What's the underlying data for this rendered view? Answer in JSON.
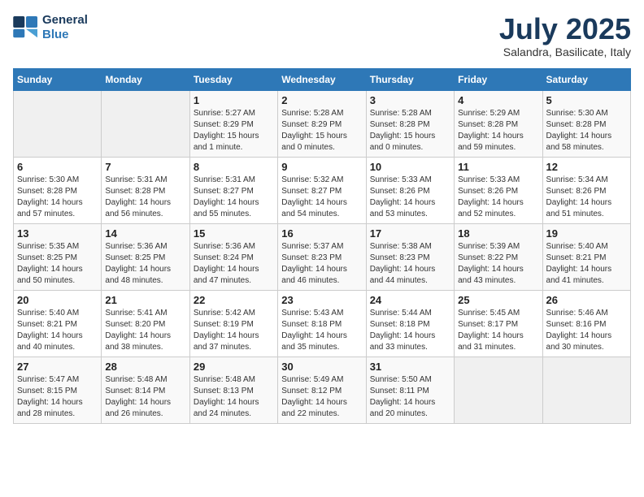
{
  "logo": {
    "line1": "General",
    "line2": "Blue"
  },
  "title": "July 2025",
  "subtitle": "Salandra, Basilicate, Italy",
  "headers": [
    "Sunday",
    "Monday",
    "Tuesday",
    "Wednesday",
    "Thursday",
    "Friday",
    "Saturday"
  ],
  "weeks": [
    [
      {
        "day": "",
        "sunrise": "",
        "sunset": "",
        "daylight": ""
      },
      {
        "day": "",
        "sunrise": "",
        "sunset": "",
        "daylight": ""
      },
      {
        "day": "1",
        "sunrise": "Sunrise: 5:27 AM",
        "sunset": "Sunset: 8:29 PM",
        "daylight": "Daylight: 15 hours and 1 minute."
      },
      {
        "day": "2",
        "sunrise": "Sunrise: 5:28 AM",
        "sunset": "Sunset: 8:29 PM",
        "daylight": "Daylight: 15 hours and 0 minutes."
      },
      {
        "day": "3",
        "sunrise": "Sunrise: 5:28 AM",
        "sunset": "Sunset: 8:28 PM",
        "daylight": "Daylight: 15 hours and 0 minutes."
      },
      {
        "day": "4",
        "sunrise": "Sunrise: 5:29 AM",
        "sunset": "Sunset: 8:28 PM",
        "daylight": "Daylight: 14 hours and 59 minutes."
      },
      {
        "day": "5",
        "sunrise": "Sunrise: 5:30 AM",
        "sunset": "Sunset: 8:28 PM",
        "daylight": "Daylight: 14 hours and 58 minutes."
      }
    ],
    [
      {
        "day": "6",
        "sunrise": "Sunrise: 5:30 AM",
        "sunset": "Sunset: 8:28 PM",
        "daylight": "Daylight: 14 hours and 57 minutes."
      },
      {
        "day": "7",
        "sunrise": "Sunrise: 5:31 AM",
        "sunset": "Sunset: 8:28 PM",
        "daylight": "Daylight: 14 hours and 56 minutes."
      },
      {
        "day": "8",
        "sunrise": "Sunrise: 5:31 AM",
        "sunset": "Sunset: 8:27 PM",
        "daylight": "Daylight: 14 hours and 55 minutes."
      },
      {
        "day": "9",
        "sunrise": "Sunrise: 5:32 AM",
        "sunset": "Sunset: 8:27 PM",
        "daylight": "Daylight: 14 hours and 54 minutes."
      },
      {
        "day": "10",
        "sunrise": "Sunrise: 5:33 AM",
        "sunset": "Sunset: 8:26 PM",
        "daylight": "Daylight: 14 hours and 53 minutes."
      },
      {
        "day": "11",
        "sunrise": "Sunrise: 5:33 AM",
        "sunset": "Sunset: 8:26 PM",
        "daylight": "Daylight: 14 hours and 52 minutes."
      },
      {
        "day": "12",
        "sunrise": "Sunrise: 5:34 AM",
        "sunset": "Sunset: 8:26 PM",
        "daylight": "Daylight: 14 hours and 51 minutes."
      }
    ],
    [
      {
        "day": "13",
        "sunrise": "Sunrise: 5:35 AM",
        "sunset": "Sunset: 8:25 PM",
        "daylight": "Daylight: 14 hours and 50 minutes."
      },
      {
        "day": "14",
        "sunrise": "Sunrise: 5:36 AM",
        "sunset": "Sunset: 8:25 PM",
        "daylight": "Daylight: 14 hours and 48 minutes."
      },
      {
        "day": "15",
        "sunrise": "Sunrise: 5:36 AM",
        "sunset": "Sunset: 8:24 PM",
        "daylight": "Daylight: 14 hours and 47 minutes."
      },
      {
        "day": "16",
        "sunrise": "Sunrise: 5:37 AM",
        "sunset": "Sunset: 8:23 PM",
        "daylight": "Daylight: 14 hours and 46 minutes."
      },
      {
        "day": "17",
        "sunrise": "Sunrise: 5:38 AM",
        "sunset": "Sunset: 8:23 PM",
        "daylight": "Daylight: 14 hours and 44 minutes."
      },
      {
        "day": "18",
        "sunrise": "Sunrise: 5:39 AM",
        "sunset": "Sunset: 8:22 PM",
        "daylight": "Daylight: 14 hours and 43 minutes."
      },
      {
        "day": "19",
        "sunrise": "Sunrise: 5:40 AM",
        "sunset": "Sunset: 8:21 PM",
        "daylight": "Daylight: 14 hours and 41 minutes."
      }
    ],
    [
      {
        "day": "20",
        "sunrise": "Sunrise: 5:40 AM",
        "sunset": "Sunset: 8:21 PM",
        "daylight": "Daylight: 14 hours and 40 minutes."
      },
      {
        "day": "21",
        "sunrise": "Sunrise: 5:41 AM",
        "sunset": "Sunset: 8:20 PM",
        "daylight": "Daylight: 14 hours and 38 minutes."
      },
      {
        "day": "22",
        "sunrise": "Sunrise: 5:42 AM",
        "sunset": "Sunset: 8:19 PM",
        "daylight": "Daylight: 14 hours and 37 minutes."
      },
      {
        "day": "23",
        "sunrise": "Sunrise: 5:43 AM",
        "sunset": "Sunset: 8:18 PM",
        "daylight": "Daylight: 14 hours and 35 minutes."
      },
      {
        "day": "24",
        "sunrise": "Sunrise: 5:44 AM",
        "sunset": "Sunset: 8:18 PM",
        "daylight": "Daylight: 14 hours and 33 minutes."
      },
      {
        "day": "25",
        "sunrise": "Sunrise: 5:45 AM",
        "sunset": "Sunset: 8:17 PM",
        "daylight": "Daylight: 14 hours and 31 minutes."
      },
      {
        "day": "26",
        "sunrise": "Sunrise: 5:46 AM",
        "sunset": "Sunset: 8:16 PM",
        "daylight": "Daylight: 14 hours and 30 minutes."
      }
    ],
    [
      {
        "day": "27",
        "sunrise": "Sunrise: 5:47 AM",
        "sunset": "Sunset: 8:15 PM",
        "daylight": "Daylight: 14 hours and 28 minutes."
      },
      {
        "day": "28",
        "sunrise": "Sunrise: 5:48 AM",
        "sunset": "Sunset: 8:14 PM",
        "daylight": "Daylight: 14 hours and 26 minutes."
      },
      {
        "day": "29",
        "sunrise": "Sunrise: 5:48 AM",
        "sunset": "Sunset: 8:13 PM",
        "daylight": "Daylight: 14 hours and 24 minutes."
      },
      {
        "day": "30",
        "sunrise": "Sunrise: 5:49 AM",
        "sunset": "Sunset: 8:12 PM",
        "daylight": "Daylight: 14 hours and 22 minutes."
      },
      {
        "day": "31",
        "sunrise": "Sunrise: 5:50 AM",
        "sunset": "Sunset: 8:11 PM",
        "daylight": "Daylight: 14 hours and 20 minutes."
      },
      {
        "day": "",
        "sunrise": "",
        "sunset": "",
        "daylight": ""
      },
      {
        "day": "",
        "sunrise": "",
        "sunset": "",
        "daylight": ""
      }
    ]
  ]
}
